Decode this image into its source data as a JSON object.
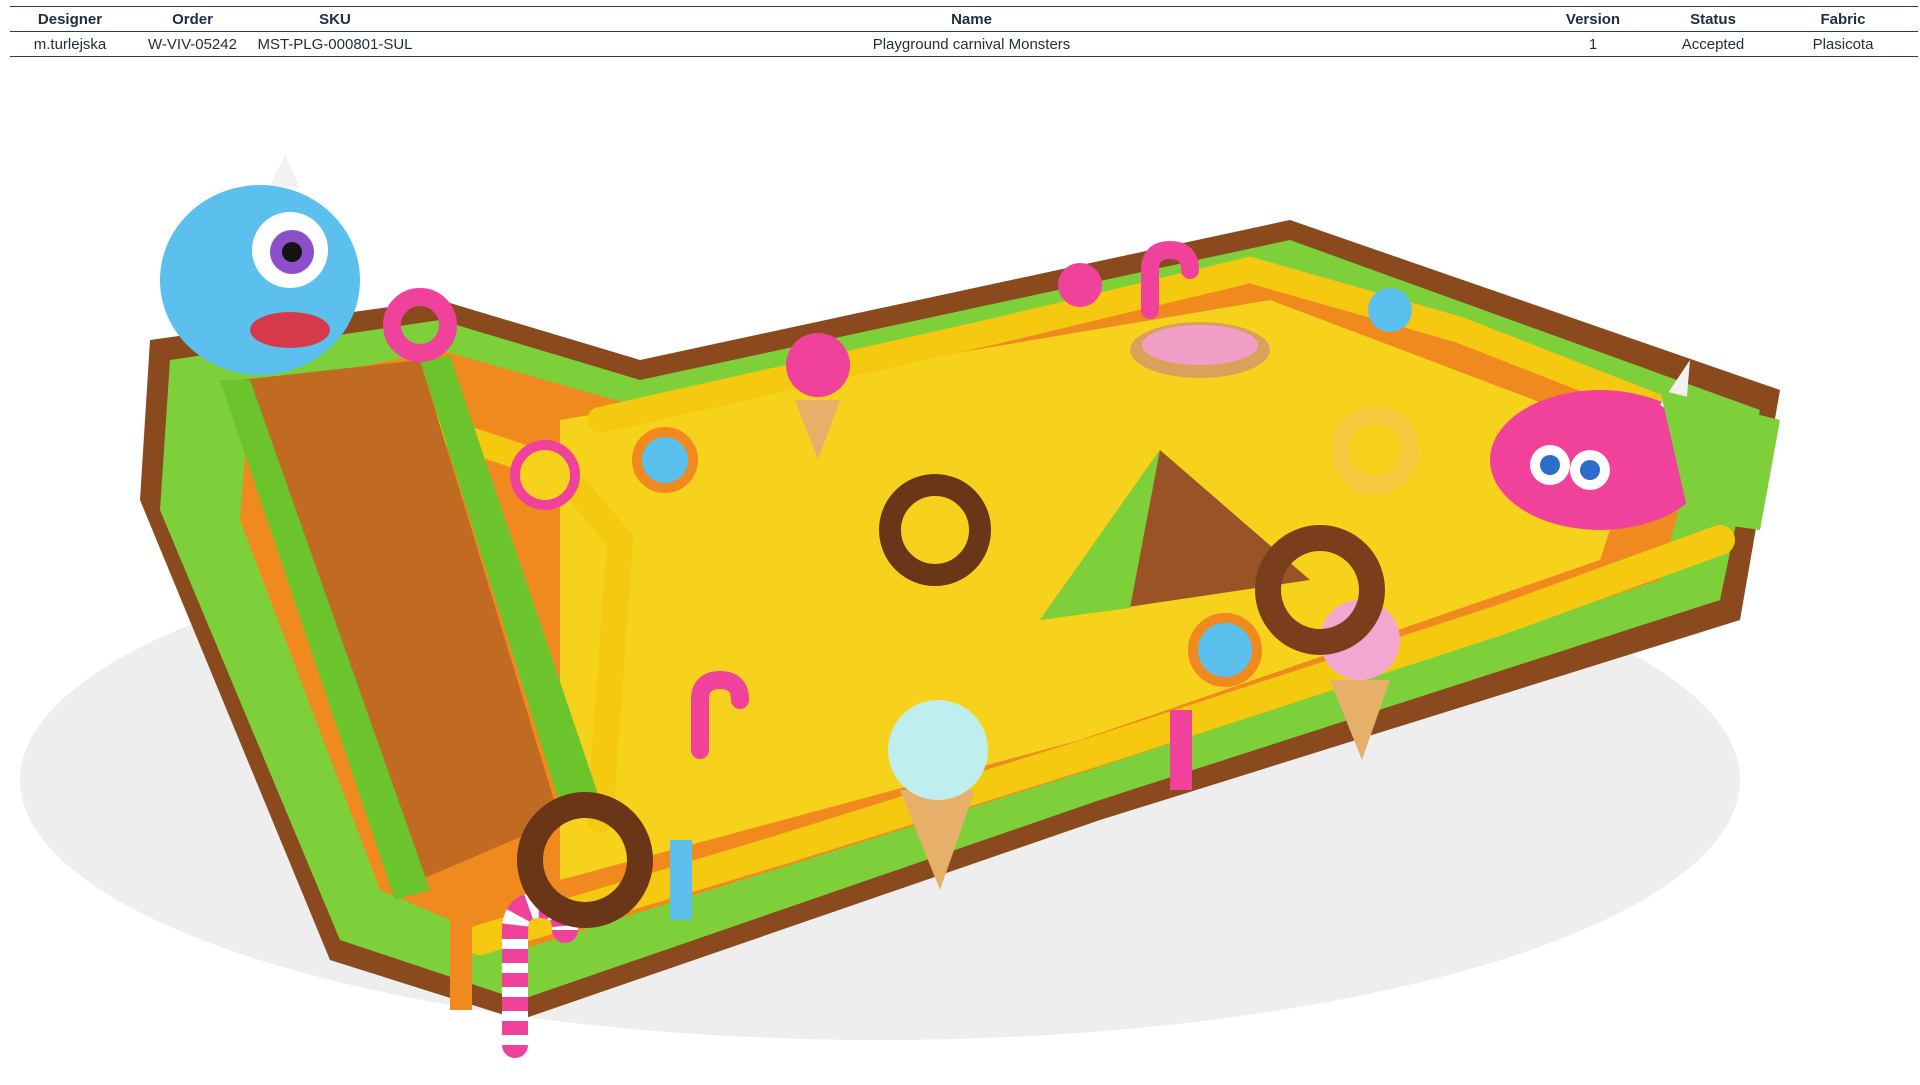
{
  "spec_table": {
    "headers": [
      "Designer",
      "Order",
      "SKU",
      "Name",
      "Version",
      "Status",
      "Fabric"
    ],
    "row": [
      "m.turlejska",
      "W-VIV-05242",
      "MST-PLG-000801-SUL",
      "Playground carnival Monsters",
      "1",
      "Accepted",
      "Plasicota"
    ]
  },
  "render": {
    "icon": "inflatable-playground-render",
    "colors": {
      "yellow": "#f7d21c",
      "orange": "#f08a1e",
      "brown": "#8a4a1e",
      "green": "#7dd03a",
      "pink": "#f0429a",
      "blue": "#5cc0ee"
    }
  }
}
